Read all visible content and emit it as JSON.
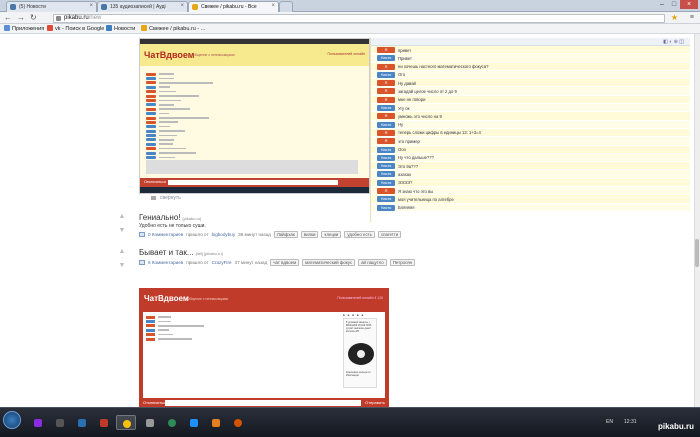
{
  "browser": {
    "tabs": [
      {
        "label": "(5) Новости",
        "color": "#4a76a8",
        "active": false
      },
      {
        "label": "135 аудиозаписей | Ауді",
        "color": "#4a76a8",
        "active": false
      },
      {
        "label": "Свежее / pikabu.ru - Все",
        "color": "#e6a817",
        "active": true
      }
    ],
    "url_domain": "pikabu.ru",
    "url_path": "/new",
    "bookmarks": [
      {
        "label": "Приложения",
        "color": "#5a8fd6"
      },
      {
        "label": "vk - Поиск в Google",
        "color": "#dd4b39"
      },
      {
        "label": "Новости",
        "color": "#3d7ebf"
      },
      {
        "label": "Свежее / pikabu.ru - ...",
        "color": "#e6a817"
      }
    ]
  },
  "screenshot1": {
    "logo": "ЧатВдвоем",
    "subtitle": "Общение с незнакомцами",
    "right_label": "Пользователей онлайн",
    "footer_btn": "Отключиться",
    "collapse_label": "свернуть"
  },
  "chat": {
    "messages": [
      {
        "who": "Я",
        "color": "#d9542b",
        "text": "привет"
      },
      {
        "who": "Настя",
        "color": "#4a86c5",
        "text": "Привет"
      },
      {
        "who": "Я",
        "color": "#d9542b",
        "text": "ни хочешь настного математического фокуса?"
      },
      {
        "who": "Настя",
        "color": "#4a86c5",
        "text": "Ого"
      },
      {
        "who": "Я",
        "color": "#d9542b",
        "text": "Ну давай"
      },
      {
        "who": "Я",
        "color": "#d9542b",
        "text": "загадай целое число от 2 до 9"
      },
      {
        "who": "Я",
        "color": "#d9542b",
        "text": "мне не говори"
      },
      {
        "who": "Настя",
        "color": "#4a86c5",
        "text": "Угу ок"
      },
      {
        "who": "Я",
        "color": "#d9542b",
        "text": "умножь это число на 9"
      },
      {
        "who": "Настя",
        "color": "#4a86c5",
        "text": "Ну"
      },
      {
        "who": "Я",
        "color": "#d9542b",
        "text": "теперь сложи цифры в единицы 13: 1+3=4"
      },
      {
        "who": "Я",
        "color": "#d9542b",
        "text": "это пример"
      },
      {
        "who": "Настя",
        "color": "#4a86c5",
        "text": "Ооо"
      },
      {
        "who": "Настя",
        "color": "#4a86c5",
        "text": "Ну что дальше???"
      },
      {
        "who": "Настя",
        "color": "#4a86c5",
        "text": "Это 9а???"
      },
      {
        "who": "Настя",
        "color": "#4a86c5",
        "text": "ахахах"
      },
      {
        "who": "Настя",
        "color": "#4a86c5",
        "text": "ЭЭЭЭ?"
      },
      {
        "who": "Я",
        "color": "#d9542b",
        "text": "Я знаю что это вы"
      },
      {
        "who": "Настя",
        "color": "#4a86c5",
        "text": "моя учительница по алгебре"
      },
      {
        "who": "Настя",
        "color": "#4a86c5",
        "text": "Бляяяяя"
      }
    ]
  },
  "posts": [
    {
      "title": "Гениально!",
      "domain": "[pikabu.ru]",
      "desc": "Удобно есть не только суши.",
      "comments": "0 Комментариев",
      "via": "пришло от",
      "author": "bigbodybuy",
      "time": "38 минут назад",
      "tags": [
        "Лайфхак",
        "вилки",
        "клецки",
        "удобно есть",
        "спагетти"
      ]
    },
    {
      "title": "Бывает и так...",
      "domain": "[tail] [pikabu.ru]",
      "desc": "",
      "comments": "6 Комментариев",
      "via": "пришло от",
      "author": "CrazyFire",
      "time": "37 минут назад",
      "tags": [
        "чат вдвоем",
        "математический фокус",
        "ай пацутло",
        "Петросян"
      ]
    }
  ],
  "screenshot2": {
    "logo": "ЧатВдвоем",
    "subtitle": "Общение с незнакомцами",
    "right_label": "Пользователей онлайн 4 126",
    "ad_text": "5 уровней защиты | ВАЖНАЯ И КАК ЯЛА сухой чемпион днатт Колеса 4/5",
    "ad_caption": "Ключевые кольца от Инспекции",
    "footer_left": "Отключиться",
    "footer_right": "Отправить",
    "brand": "pikabu.ru"
  },
  "taskbar": {
    "lang": "EN",
    "time": "12:31",
    "watermark": "pikabu.ru"
  }
}
